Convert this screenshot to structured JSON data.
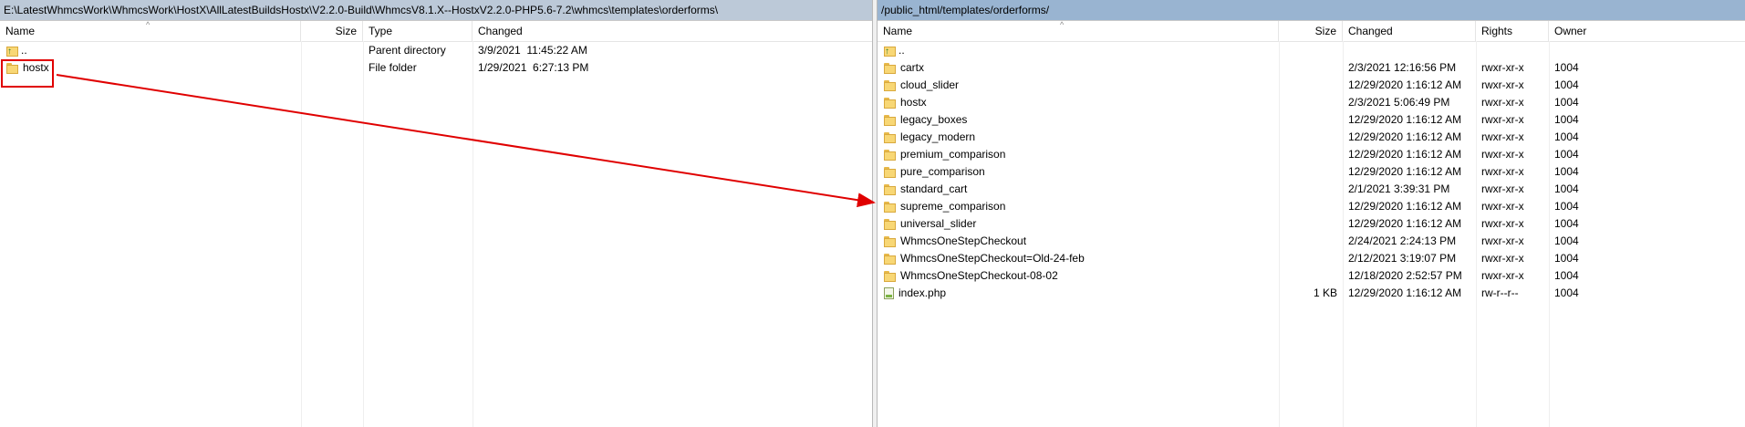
{
  "left_pane": {
    "path": "E:\\LatestWhmcsWork\\WhmcsWork\\HostX\\AllLatestBuildsHostx\\V2.2.0-Build\\WhmcsV8.1.X--HostxV2.2.0-PHP5.6-7.2\\whmcs\\templates\\orderforms\\",
    "columns": {
      "name": "Name",
      "size": "Size",
      "type": "Type",
      "changed": "Changed"
    },
    "rows": [
      {
        "name": "..",
        "size": "",
        "type": "Parent directory",
        "changed": "3/9/2021  11:45:22 AM",
        "icon": "parent-folder-icon"
      },
      {
        "name": "hostx",
        "size": "",
        "type": "File folder",
        "changed": "1/29/2021  6:27:13 PM",
        "icon": "folder-icon"
      }
    ]
  },
  "right_pane": {
    "path": "/public_html/templates/orderforms/",
    "columns": {
      "name": "Name",
      "size": "Size",
      "changed": "Changed",
      "rights": "Rights",
      "owner": "Owner"
    },
    "rows": [
      {
        "name": "..",
        "size": "",
        "changed": "",
        "rights": "",
        "owner": "",
        "icon": "parent-folder-icon"
      },
      {
        "name": "cartx",
        "size": "",
        "changed": "2/3/2021 12:16:56 PM",
        "rights": "rwxr-xr-x",
        "owner": "1004",
        "icon": "folder-icon"
      },
      {
        "name": "cloud_slider",
        "size": "",
        "changed": "12/29/2020 1:16:12 AM",
        "rights": "rwxr-xr-x",
        "owner": "1004",
        "icon": "folder-icon"
      },
      {
        "name": "hostx",
        "size": "",
        "changed": "2/3/2021 5:06:49 PM",
        "rights": "rwxr-xr-x",
        "owner": "1004",
        "icon": "folder-icon"
      },
      {
        "name": "legacy_boxes",
        "size": "",
        "changed": "12/29/2020 1:16:12 AM",
        "rights": "rwxr-xr-x",
        "owner": "1004",
        "icon": "folder-icon"
      },
      {
        "name": "legacy_modern",
        "size": "",
        "changed": "12/29/2020 1:16:12 AM",
        "rights": "rwxr-xr-x",
        "owner": "1004",
        "icon": "folder-icon"
      },
      {
        "name": "premium_comparison",
        "size": "",
        "changed": "12/29/2020 1:16:12 AM",
        "rights": "rwxr-xr-x",
        "owner": "1004",
        "icon": "folder-icon"
      },
      {
        "name": "pure_comparison",
        "size": "",
        "changed": "12/29/2020 1:16:12 AM",
        "rights": "rwxr-xr-x",
        "owner": "1004",
        "icon": "folder-icon"
      },
      {
        "name": "standard_cart",
        "size": "",
        "changed": "2/1/2021 3:39:31 PM",
        "rights": "rwxr-xr-x",
        "owner": "1004",
        "icon": "folder-icon"
      },
      {
        "name": "supreme_comparison",
        "size": "",
        "changed": "12/29/2020 1:16:12 AM",
        "rights": "rwxr-xr-x",
        "owner": "1004",
        "icon": "folder-icon"
      },
      {
        "name": "universal_slider",
        "size": "",
        "changed": "12/29/2020 1:16:12 AM",
        "rights": "rwxr-xr-x",
        "owner": "1004",
        "icon": "folder-icon"
      },
      {
        "name": "WhmcsOneStepCheckout",
        "size": "",
        "changed": "2/24/2021 2:24:13 PM",
        "rights": "rwxr-xr-x",
        "owner": "1004",
        "icon": "folder-icon"
      },
      {
        "name": "WhmcsOneStepCheckout=Old-24-feb",
        "size": "",
        "changed": "2/12/2021 3:19:07 PM",
        "rights": "rwxr-xr-x",
        "owner": "1004",
        "icon": "folder-icon"
      },
      {
        "name": "WhmcsOneStepCheckout-08-02",
        "size": "",
        "changed": "12/18/2020 2:52:57 PM",
        "rights": "rwxr-xr-x",
        "owner": "1004",
        "icon": "folder-icon"
      },
      {
        "name": "index.php",
        "size": "1 KB",
        "changed": "12/29/2020 1:16:12 AM",
        "rights": "rw-r--r--",
        "owner": "1004",
        "icon": "php-file-icon"
      }
    ]
  },
  "annotation": {
    "highlight_color": "#e00000"
  },
  "colors": {
    "left_path_bg": "#bcc9d8",
    "right_path_bg": "#99b4d1",
    "folder": "#f8d775"
  }
}
